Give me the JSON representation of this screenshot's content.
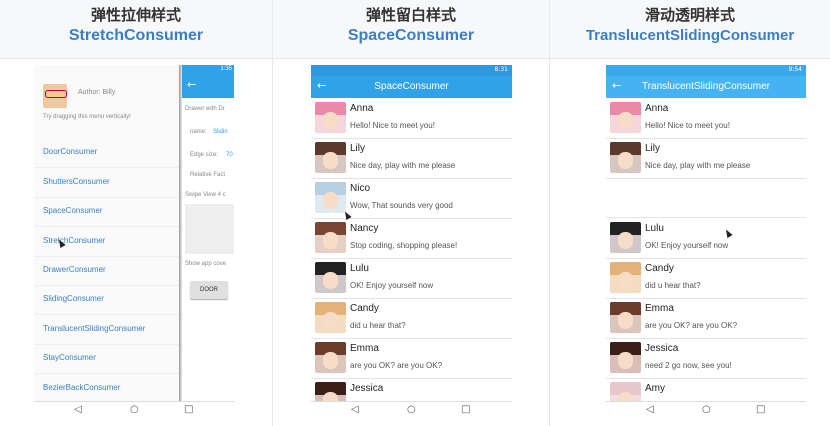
{
  "panels": [
    {
      "title_cn": "弹性拉伸样式",
      "title_en": "StretchConsumer"
    },
    {
      "title_cn": "弹性留白样式",
      "title_en": "SpaceConsumer"
    },
    {
      "title_cn": "滑动透明样式",
      "title_en": "TranslucentSlidingConsumer"
    }
  ],
  "colors": {
    "accent": "#3b7fc2",
    "appbar": "#2fa2ea",
    "appbar_light": "#45b3f2"
  },
  "icons": {
    "back": "arrow-left-icon",
    "nav_back": "triangle-back-icon",
    "nav_home": "circle-home-icon",
    "nav_recent": "square-recent-icon"
  },
  "stretch": {
    "status_time": "1:35",
    "author": "Author: Billy",
    "hint": "Try dragging this menu vertically!",
    "menu": [
      "DoorConsumer",
      "ShuttersConsumer",
      "SpaceConsumer",
      "StretchConsumer",
      "DrawerConsumer",
      "SlidingConsumer",
      "TranslucentSlidingConsumer",
      "StayConsumer",
      "BezierBackConsumer"
    ],
    "right": {
      "drawer_with": "Drawer with Dr",
      "name_label": "name:",
      "name_value": "Slidin",
      "edge_label": "Edge size:",
      "edge_value": "70",
      "relative": "Relative Fact",
      "swipe": "Swipe View 4 c",
      "show_app": "Show app cove",
      "door_btn": "DOOR"
    }
  },
  "space": {
    "status_time": "8:31",
    "title": "SpaceConsumer",
    "chats": [
      {
        "name": "Anna",
        "msg": "Hello! Nice to meet you!"
      },
      {
        "name": "Lily",
        "msg": "Nice day, play with me please"
      },
      {
        "name": "Nico",
        "msg": "Wow, That sounds very good"
      },
      {
        "name": "Nancy",
        "msg": "Stop coding, shopping please!"
      },
      {
        "name": "Lulu",
        "msg": "OK! Enjoy yourself now"
      },
      {
        "name": "Candy",
        "msg": "did u hear that?"
      },
      {
        "name": "Emma",
        "msg": "are you OK? are you OK?"
      },
      {
        "name": "Jessica",
        "msg": ""
      }
    ]
  },
  "translucent": {
    "status_time": "9:54",
    "title": "TranslucentSlidingConsumer",
    "chats_top": [
      {
        "name": "Anna",
        "msg": "Hello! Nice to meet you!"
      },
      {
        "name": "Lily",
        "msg": "Nice day, play with me please"
      }
    ],
    "chats_bottom": [
      {
        "name": "Lulu",
        "msg": "OK! Enjoy yourself now"
      },
      {
        "name": "Candy",
        "msg": "did u hear that?"
      },
      {
        "name": "Emma",
        "msg": "are you OK? are you OK?"
      },
      {
        "name": "Jessica",
        "msg": "need 2 go now, see you!"
      },
      {
        "name": "Amy",
        "msg": ""
      }
    ]
  }
}
